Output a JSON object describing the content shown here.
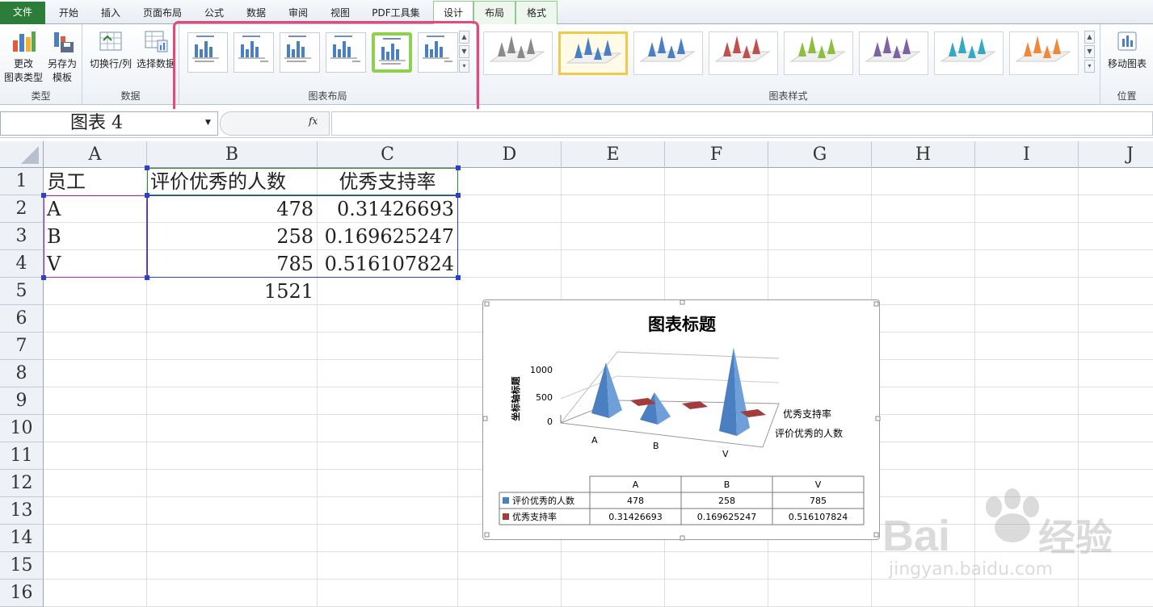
{
  "tabs": [
    "文件",
    "开始",
    "插入",
    "页面布局",
    "公式",
    "数据",
    "审阅",
    "视图",
    "PDF工具集",
    "设计",
    "布局",
    "格式"
  ],
  "ribbon": {
    "type_group": {
      "btn1_l1": "更改",
      "btn1_l2": "图表类型",
      "btn2_l1": "另存为",
      "btn2_l2": "模板",
      "label": "类型"
    },
    "data_group": {
      "switch": "切换行/列",
      "select": "选择数据",
      "label": "数据"
    },
    "layout_group": {
      "label": "图表布局"
    },
    "style_group": {
      "label": "图表样式",
      "colors": [
        "#8a8a8a",
        "#4a7fc1",
        "#4a7fc1",
        "#c0504d",
        "#8cbf3f",
        "#7e62a1",
        "#34a9c4",
        "#f0883a"
      ]
    },
    "location_group": {
      "move": "移动图表",
      "label": "位置"
    }
  },
  "formula_bar": {
    "name_box": "图表 4",
    "fx": "fx",
    "formula": ""
  },
  "columns": [
    "A",
    "B",
    "C",
    "D",
    "E",
    "F",
    "G",
    "H",
    "I",
    "J"
  ],
  "rows": [
    "1",
    "2",
    "3",
    "4",
    "5",
    "6",
    "7",
    "8",
    "9",
    "10",
    "11",
    "12",
    "13",
    "14",
    "15",
    "16"
  ],
  "cells": {
    "A1": "员工",
    "B1": "评价优秀的人数",
    "C1": "优秀支持率",
    "A2": "A",
    "B2": "478",
    "C2": "0.31426693",
    "A3": "B",
    "B3": "258",
    "C3": "0.169625247",
    "A4": "V",
    "B4": "785",
    "C4": "0.516107824",
    "B5": "1521"
  },
  "chart_data": {
    "type": "bar",
    "title": "图表标题",
    "ylabel": "坐标轴标题",
    "categories": [
      "A",
      "B",
      "V"
    ],
    "ylim": [
      0,
      1000
    ],
    "yticks": [
      "1000",
      "500",
      "0"
    ],
    "series": [
      {
        "name": "评价优秀的人数",
        "values": [
          478,
          258,
          785
        ],
        "color": "#4a7fc1"
      },
      {
        "name": "优秀支持率",
        "values": [
          0.31426693,
          0.169625247,
          0.516107824
        ],
        "color": "#a33d3d"
      }
    ],
    "data_table": {
      "headers": [
        "A",
        "B",
        "V"
      ],
      "rows": [
        {
          "name": "评价优秀的人数",
          "values": [
            "478",
            "258",
            "785"
          ]
        },
        {
          "name": "优秀支持率",
          "values": [
            "0.31426693",
            "0.169625247",
            "0.516107824"
          ]
        }
      ]
    }
  },
  "watermark": {
    "brand": "Bai",
    "cn": "经验",
    "url": "jingyan.baidu.com"
  }
}
